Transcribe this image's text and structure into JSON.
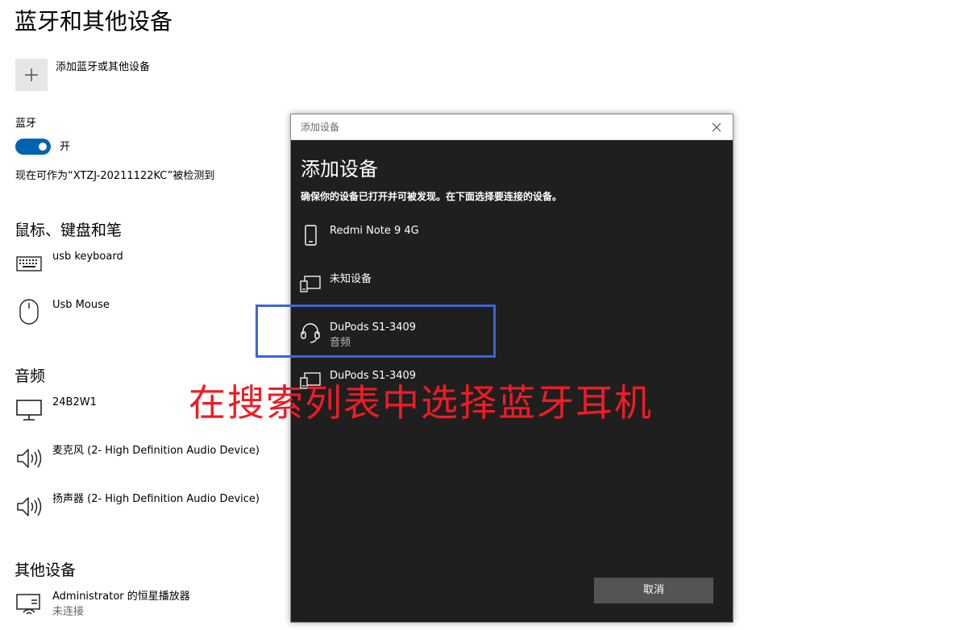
{
  "page": {
    "title": "蓝牙和其他设备",
    "add_label": "添加蓝牙或其他设备",
    "bluetooth_label": "蓝牙",
    "toggle_state": "开",
    "discoverable_text": "现在可作为“XTZJ-20211122KC”被检测到"
  },
  "sections": {
    "input": {
      "title": "鼠标、键盘和笔",
      "devices": [
        {
          "name": "usb keyboard",
          "icon": "keyboard-icon"
        },
        {
          "name": "Usb Mouse",
          "icon": "mouse-icon"
        }
      ]
    },
    "audio": {
      "title": "音频",
      "devices": [
        {
          "name": "24B2W1",
          "icon": "monitor-icon"
        },
        {
          "name": "麦克风 (2- High Definition Audio Device)",
          "icon": "speaker-icon"
        },
        {
          "name": "扬声器 (2- High Definition Audio Device)",
          "icon": "speaker-icon"
        }
      ]
    },
    "other": {
      "title": "其他设备",
      "devices": [
        {
          "name": "Administrator 的恒星播放器",
          "status": "未连接",
          "icon": "media-device-icon"
        }
      ]
    }
  },
  "dialog": {
    "window_title": "添加设备",
    "heading": "添加设备",
    "description": "确保你的设备已打开并可被发现。在下面选择要连接的设备。",
    "items": [
      {
        "name": "Redmi Note 9 4G",
        "icon": "phone-icon"
      },
      {
        "name": "未知设备",
        "icon": "generic-device-icon"
      },
      {
        "name": "DuPods S1-3409",
        "sub": "音频",
        "icon": "headset-icon"
      },
      {
        "name": "DuPods S1-3409",
        "icon": "generic-device-icon"
      }
    ],
    "cancel_label": "取消"
  },
  "annotation": {
    "text": "在搜索列表中选择蓝牙耳机",
    "color": "#ee1c25",
    "highlight_color": "#3a66d6"
  },
  "colors": {
    "accent": "#0063b1",
    "dialog_bg": "#1f1f1f",
    "cancel_bg": "#545454"
  }
}
